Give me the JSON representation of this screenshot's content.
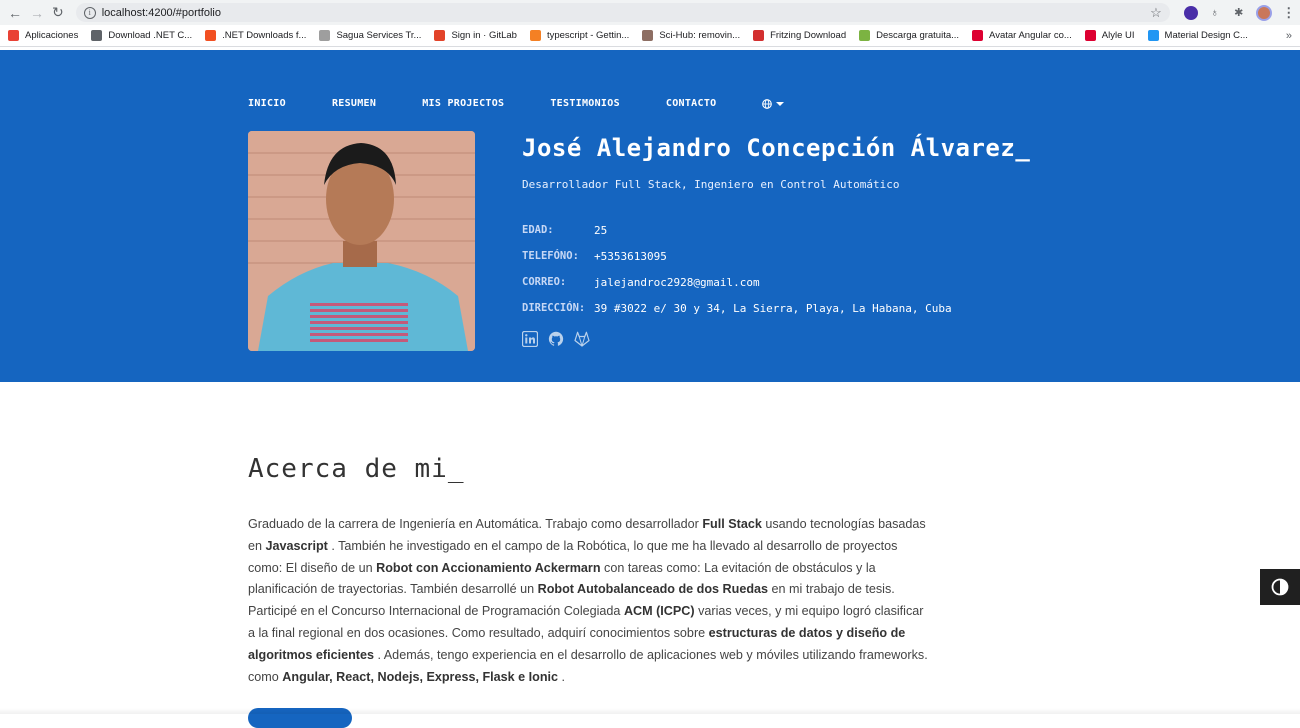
{
  "browser": {
    "url": "localhost:4200/#portfolio",
    "bookmarks": [
      {
        "label": "Aplicaciones",
        "color": "#e94235"
      },
      {
        "label": "Download .NET C...",
        "color": "#5f6368"
      },
      {
        "label": ".NET Downloads f...",
        "color": "#f25022"
      },
      {
        "label": "Sagua Services Tr...",
        "color": "#9e9e9e"
      },
      {
        "label": "Sign in · GitLab",
        "color": "#e24329"
      },
      {
        "label": "typescript - Gettin...",
        "color": "#f48024"
      },
      {
        "label": "Sci-Hub: removin...",
        "color": "#8d6e63"
      },
      {
        "label": "Fritzing Download",
        "color": "#d32f2f"
      },
      {
        "label": "Descarga gratuita...",
        "color": "#7cb342"
      },
      {
        "label": "Avatar Angular co...",
        "color": "#dd0031"
      },
      {
        "label": "Alyle UI",
        "color": "#dd0031"
      },
      {
        "label": "Material Design C...",
        "color": "#2196f3"
      }
    ],
    "more": "»"
  },
  "nav": {
    "items": [
      "INICIO",
      "RESUMEN",
      "MIS PROJECTOS",
      "TESTIMONIOS",
      "CONTACTO"
    ],
    "lang_icon": "globe-icon"
  },
  "profile": {
    "name": "José Alejandro Concepción Álvarez_",
    "subtitle": "Desarrollador Full Stack, Ingeniero en Control Automático",
    "details": [
      {
        "key": "EDAD:",
        "value": "25"
      },
      {
        "key": "TELEFÓNO:",
        "value": "+5353613095"
      },
      {
        "key": "CORREO:",
        "value": "jalejandroc2928@gmail.com"
      },
      {
        "key": "DIRECCIÓN:",
        "value": "39 #3022 e/ 30 y 34, La Sierra, Playa, La Habana, Cuba"
      }
    ],
    "socials": [
      "linkedin-icon",
      "github-icon",
      "gitlab-icon"
    ]
  },
  "about": {
    "title": "Acerca de mi_",
    "segments": [
      {
        "t": "Graduado de la carrera de Ingeniería en Automática. Trabajo como desarrollador ",
        "b": false
      },
      {
        "t": "Full Stack",
        "b": true
      },
      {
        "t": " usando tecnologías basadas en ",
        "b": false
      },
      {
        "t": "Javascript",
        "b": true
      },
      {
        "t": " . También he investigado en el campo de la Robótica, lo que me ha llevado al desarrollo de proyectos como: El diseño de un ",
        "b": false
      },
      {
        "t": "Robot con Accionamiento Ackermarn",
        "b": true
      },
      {
        "t": " con tareas como: La evitación de obstáculos y la planificación de trayectorias. También desarrollé un ",
        "b": false
      },
      {
        "t": "Robot Autobalanceado de dos Ruedas",
        "b": true
      },
      {
        "t": " en mi trabajo de tesis. Participé en el Concurso Internacional de Programación Colegiada ",
        "b": false
      },
      {
        "t": "ACM (ICPC)",
        "b": true
      },
      {
        "t": " varias veces, y mi equipo logró clasificar a la final regional en dos ocasiones. Como resultado, adquirí conocimientos sobre ",
        "b": false
      },
      {
        "t": "estructuras de datos y diseño de algoritmos eficientes",
        "b": true
      },
      {
        "t": " . Además, tengo experiencia en el desarrollo de aplicaciones web y móviles utilizando frameworks. como ",
        "b": false
      },
      {
        "t": "Angular, React, Nodejs, Express, Flask e Ionic",
        "b": true
      },
      {
        "t": " .",
        "b": false
      }
    ]
  },
  "colors": {
    "primary": "#1565c0",
    "toggle": "#202020"
  }
}
